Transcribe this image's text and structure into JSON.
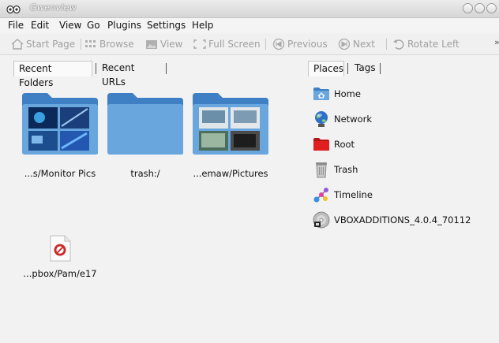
{
  "window": {
    "title": "Gwenview"
  },
  "menu": [
    {
      "label": "File"
    },
    {
      "label": "Edit"
    },
    {
      "label": "View"
    },
    {
      "label": "Go"
    },
    {
      "label": "Plugins"
    },
    {
      "label": "Settings"
    },
    {
      "label": "Help"
    }
  ],
  "toolbar": {
    "start_page": "Start Page",
    "browse": "Browse",
    "view": "View",
    "full_screen": "Full Screen",
    "previous": "Previous",
    "next": "Next",
    "rotate_left": "Rotate Left"
  },
  "left_tabs": {
    "recent_folders": "Recent Folders",
    "recent_urls": "Recent URLs"
  },
  "recent_folders": [
    {
      "label": "...s/Monitor Pics"
    },
    {
      "label": "trash:/"
    },
    {
      "label": "...emaw/Pictures"
    },
    {
      "label": "...pbox/Pam/e17"
    }
  ],
  "right_tabs": {
    "places": "Places",
    "tags": "Tags"
  },
  "places": [
    {
      "label": "Home",
      "icon": "home-folder-icon"
    },
    {
      "label": "Network",
      "icon": "network-globe-icon"
    },
    {
      "label": "Root",
      "icon": "red-folder-icon"
    },
    {
      "label": "Trash",
      "icon": "trash-can-icon"
    },
    {
      "label": "Timeline",
      "icon": "timeline-icon"
    },
    {
      "label": "VBOXADDITIONS_4.0.4_70112",
      "icon": "optical-disc-icon"
    }
  ],
  "colors": {
    "folder": "#6aa6de",
    "folder_dark": "#3f7fc4",
    "blocked": "#cc2b2b"
  }
}
